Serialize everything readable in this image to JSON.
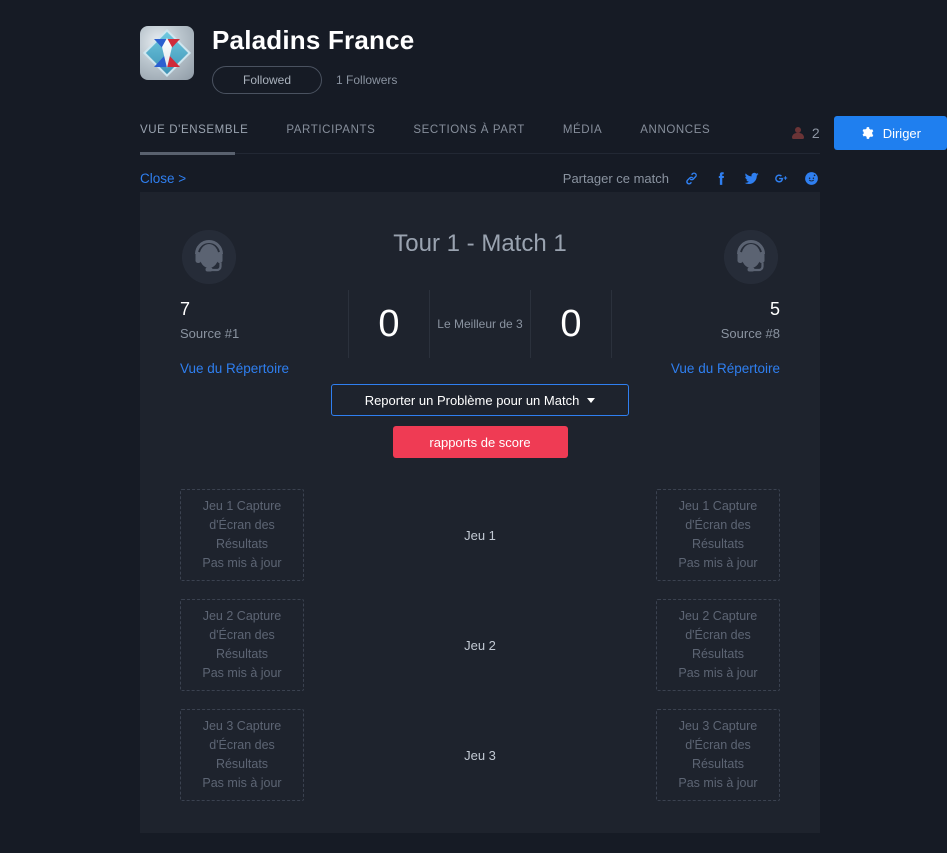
{
  "header": {
    "org_name": "Paladins France",
    "logo_icon": "paladins-diamond-logo",
    "follow_button": "Followed",
    "followers": "1 Followers",
    "participants_icon": "person-icon",
    "participants_count": "2",
    "manage_button": "Diriger",
    "manage_icon": "gear-icon",
    "accent_blue": "#1f7fef"
  },
  "nav": {
    "tabs": [
      {
        "label": "VUE D'ENSEMBLE",
        "active": true
      },
      {
        "label": "PARTICIPANTS",
        "active": false
      },
      {
        "label": "SECTIONS À PART",
        "active": false
      },
      {
        "label": "MÉDIA",
        "active": false
      },
      {
        "label": "ANNONCES",
        "active": false
      }
    ]
  },
  "share": {
    "close_label": "Close >",
    "share_label": "Partager ce match",
    "icons": [
      {
        "name": "link-icon"
      },
      {
        "name": "facebook-icon"
      },
      {
        "name": "twitter-icon"
      },
      {
        "name": "google-plus-icon"
      },
      {
        "name": "reddit-icon"
      }
    ],
    "link_color": "#2f7ff0"
  },
  "match": {
    "title": "Tour 1 - Match 1",
    "best_of": "Le Meilleur de 3",
    "left": {
      "avatar_icon": "headset-avatar-icon",
      "score": "7",
      "seed": "Source #1",
      "roster_link": "Vue du Répertoire",
      "match_score": "0"
    },
    "right": {
      "avatar_icon": "headset-avatar-icon",
      "score": "5",
      "seed": "Source #8",
      "roster_link": "Vue du Répertoire",
      "match_score": "0"
    }
  },
  "actions": {
    "report_issue": "Reporter un Problème pour un Match",
    "report_caret_icon": "chevron-down-icon",
    "score_reports": "rapports de score",
    "report_border_color": "#2f7ff0",
    "score_button_color": "#ef3b54"
  },
  "games": [
    {
      "label": "Jeu 1",
      "left_screenshot_title": "Jeu 1 Capture d'Écran des Résultats",
      "left_screenshot_status": "Pas mis à jour",
      "right_screenshot_title": "Jeu 1 Capture d'Écran des Résultats",
      "right_screenshot_status": "Pas mis à jour"
    },
    {
      "label": "Jeu 2",
      "left_screenshot_title": "Jeu 2 Capture d'Écran des Résultats",
      "left_screenshot_status": "Pas mis à jour",
      "right_screenshot_title": "Jeu 2 Capture d'Écran des Résultats",
      "right_screenshot_status": "Pas mis à jour"
    },
    {
      "label": "Jeu 3",
      "left_screenshot_title": "Jeu 3 Capture d'Écran des Résultats",
      "left_screenshot_status": "Pas mis à jour",
      "right_screenshot_title": "Jeu 3 Capture d'Écran des Résultats",
      "right_screenshot_status": "Pas mis à jour"
    }
  ]
}
